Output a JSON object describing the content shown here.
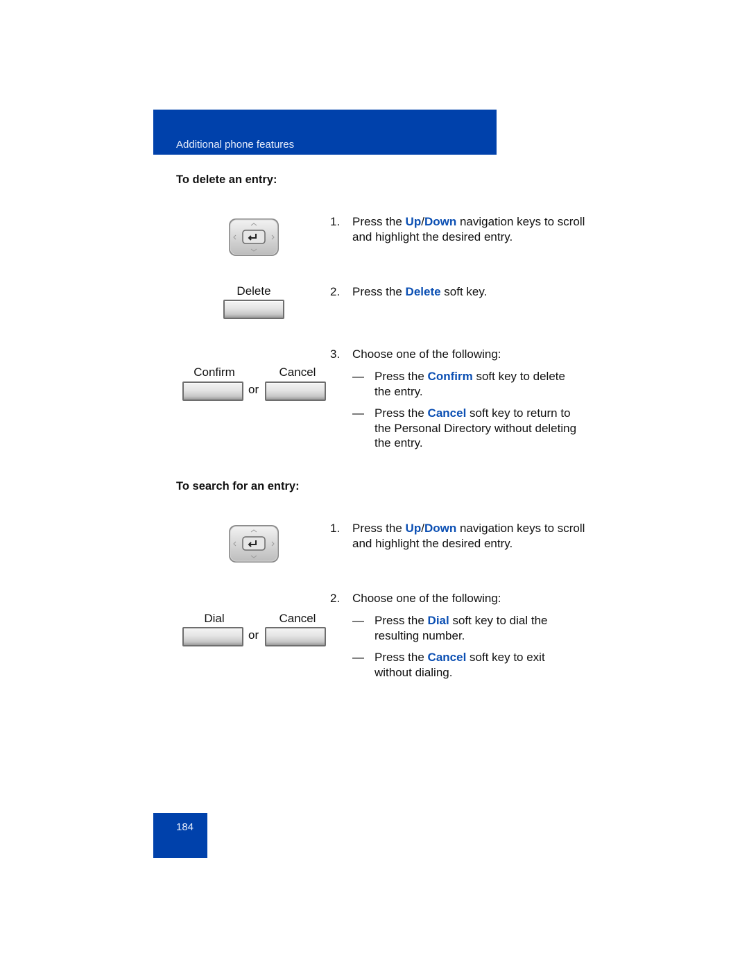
{
  "header": {
    "title": "Additional phone features",
    "color": "#0041ab"
  },
  "accent_color": "#0b4fb3",
  "delete_section": {
    "heading": "To delete an entry:",
    "nav_icon": "navigation-cluster-icon",
    "delete_key_label": "Delete",
    "confirm_key_label": "Confirm",
    "cancel_key_label": "Cancel",
    "or_label": "or",
    "steps": [
      {
        "num": "1.",
        "pre": "Press the ",
        "hl1": "Up",
        "sep": "/",
        "hl2": "Down",
        "post": " navigation keys to scroll and highlight the desired entry."
      },
      {
        "num": "2.",
        "pre": "Press the ",
        "hl": "Delete",
        "post": " soft key."
      },
      {
        "num": "3.",
        "text": "Choose one of the following:"
      }
    ],
    "options": [
      {
        "dash": "—",
        "pre": "Press the ",
        "hl": "Confirm",
        "post": " soft key to delete the entry."
      },
      {
        "dash": "—",
        "pre": "Press the ",
        "hl": "Cancel",
        "post": " soft key to return to the Personal Directory without deleting the entry."
      }
    ]
  },
  "search_section": {
    "heading": "To search for an entry:",
    "nav_icon": "navigation-cluster-icon",
    "dial_key_label": "Dial",
    "cancel_key_label": "Cancel",
    "or_label": "or",
    "steps": [
      {
        "num": "1.",
        "pre": "Press the ",
        "hl1": "Up",
        "sep": "/",
        "hl2": "Down",
        "post": " navigation keys to scroll and highlight the desired entry."
      },
      {
        "num": "2.",
        "text": "Choose one of the following:"
      }
    ],
    "options": [
      {
        "dash": "—",
        "pre": "Press the ",
        "hl": "Dial",
        "post": " soft key to dial the resulting number."
      },
      {
        "dash": "—",
        "pre": "Press the ",
        "hl": "Cancel",
        "post": " soft key to exit without dialing."
      }
    ]
  },
  "footer": {
    "page_number": "184"
  }
}
